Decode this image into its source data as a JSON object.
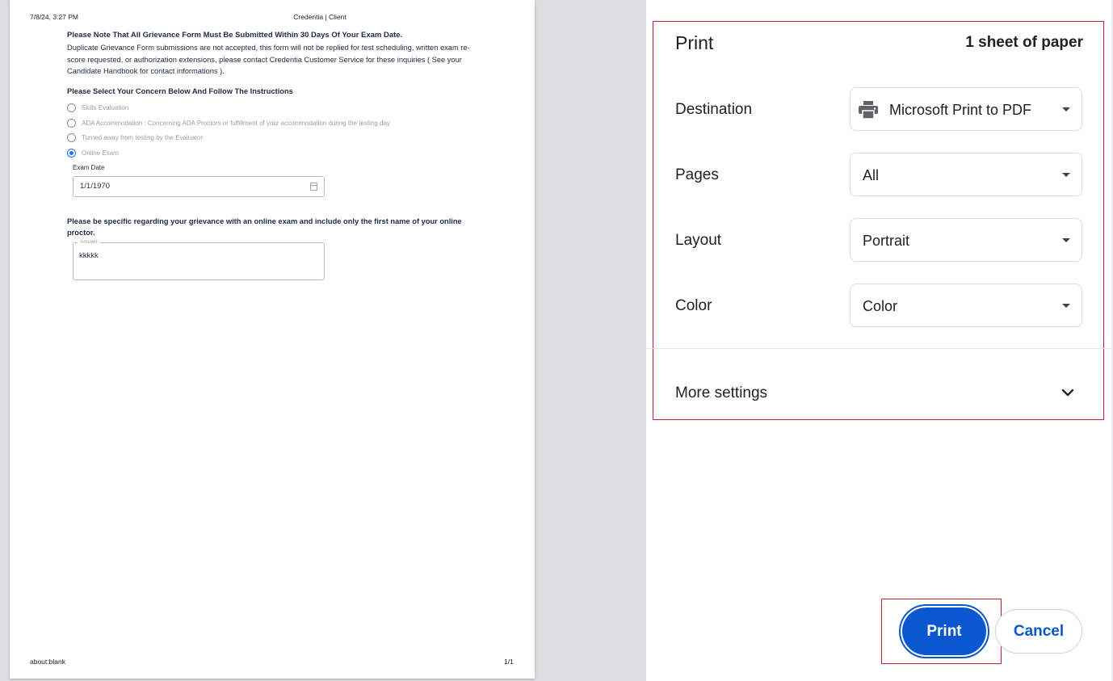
{
  "preview": {
    "header_date": "7/8/24, 3:27 PM",
    "header_title": "Credentia | Client",
    "footer_url": "about:blank",
    "footer_page": "1/1",
    "note_title": "Please Note That All Grievance Form Must Be Submitted Within 30 Days Of Your Exam Date.",
    "note_body": "Duplicate Grievance Form submissions are not accepted, this form will not be replied for test scheduling, written exam re-score requested, or authorization extensions, please contact Credentia Customer Service for these inquiries ( See your Candidate Handbook for contact informations ).",
    "select_title": "Please Select Your Concern Below And Follow The Instructions",
    "options": [
      {
        "label": "Skills Evaluation",
        "selected": false
      },
      {
        "label": "ADA Accommodation : Concerning ADA Proctors or fulfillment of your accommodation during the testing day",
        "selected": false
      },
      {
        "label": "Turned away from testing by the Evaluator",
        "selected": false
      },
      {
        "label": "Online Exam",
        "selected": true
      }
    ],
    "exam_date_label": "Exam Date",
    "exam_date_value": "1/1/1970",
    "question": "Please be specific regarding your grievance with an online exam and include only the first name of your online proctor.",
    "answer_label": "Answer",
    "answer_value": "kkkkk"
  },
  "panel": {
    "title": "Print",
    "sheet_count": "1 sheet of paper",
    "destination": {
      "label": "Destination",
      "value": "Microsoft Print to PDF",
      "icon": "printer-icon"
    },
    "pages": {
      "label": "Pages",
      "value": "All"
    },
    "layout": {
      "label": "Layout",
      "value": "Portrait"
    },
    "color": {
      "label": "Color",
      "value": "Color"
    },
    "more_settings": "More settings",
    "print_button": "Print",
    "cancel_button": "Cancel"
  },
  "colors": {
    "accent": "#0b57d0",
    "highlight_border": "#cc1f2d",
    "preview_background": "#dcdee2"
  }
}
